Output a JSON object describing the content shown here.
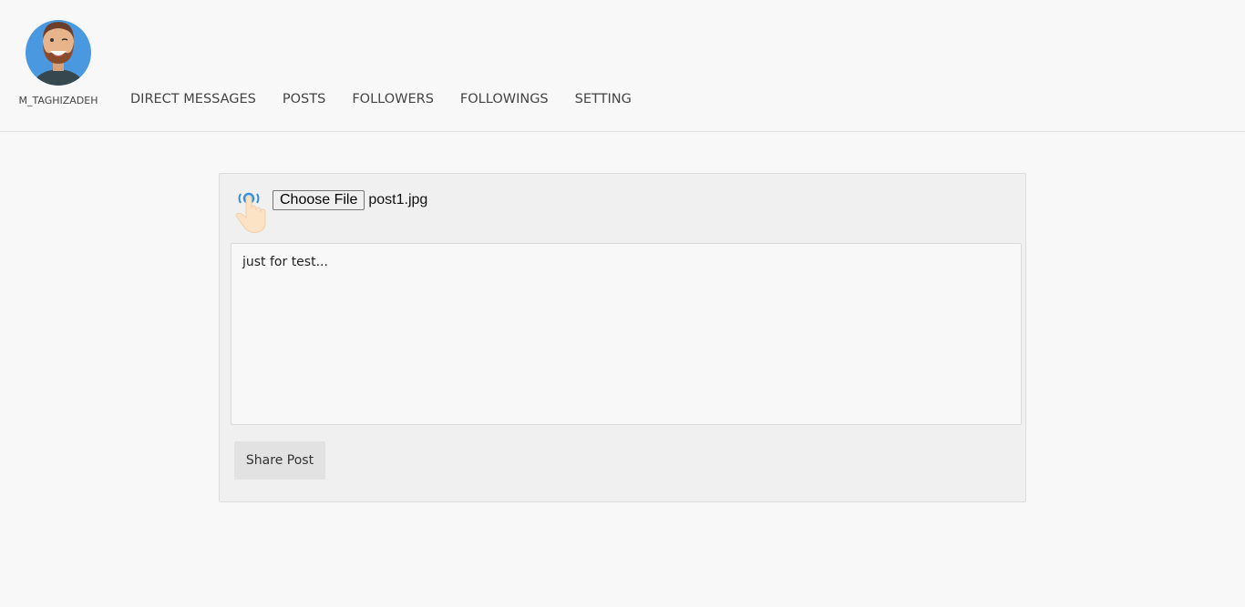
{
  "header": {
    "username": "M_TAGHIZADEH",
    "avatar_icon": "winking-bearded-man-avatar",
    "nav": [
      {
        "label": "DIRECT MESSAGES"
      },
      {
        "label": "POSTS"
      },
      {
        "label": "FOLLOWERS"
      },
      {
        "label": "FOLLOWINGS"
      },
      {
        "label": "SETTING"
      }
    ]
  },
  "post_form": {
    "upload_icon": "tap-hand-icon",
    "choose_file_label": "Choose File",
    "file_name": "post1.jpg",
    "caption_value": "just for test...",
    "share_label": "Share Post"
  },
  "colors": {
    "background": "#f8f8f8",
    "panel": "#f0f0f0",
    "avatar_bg": "#4a98e0",
    "button_bg": "#e2e2e2"
  }
}
